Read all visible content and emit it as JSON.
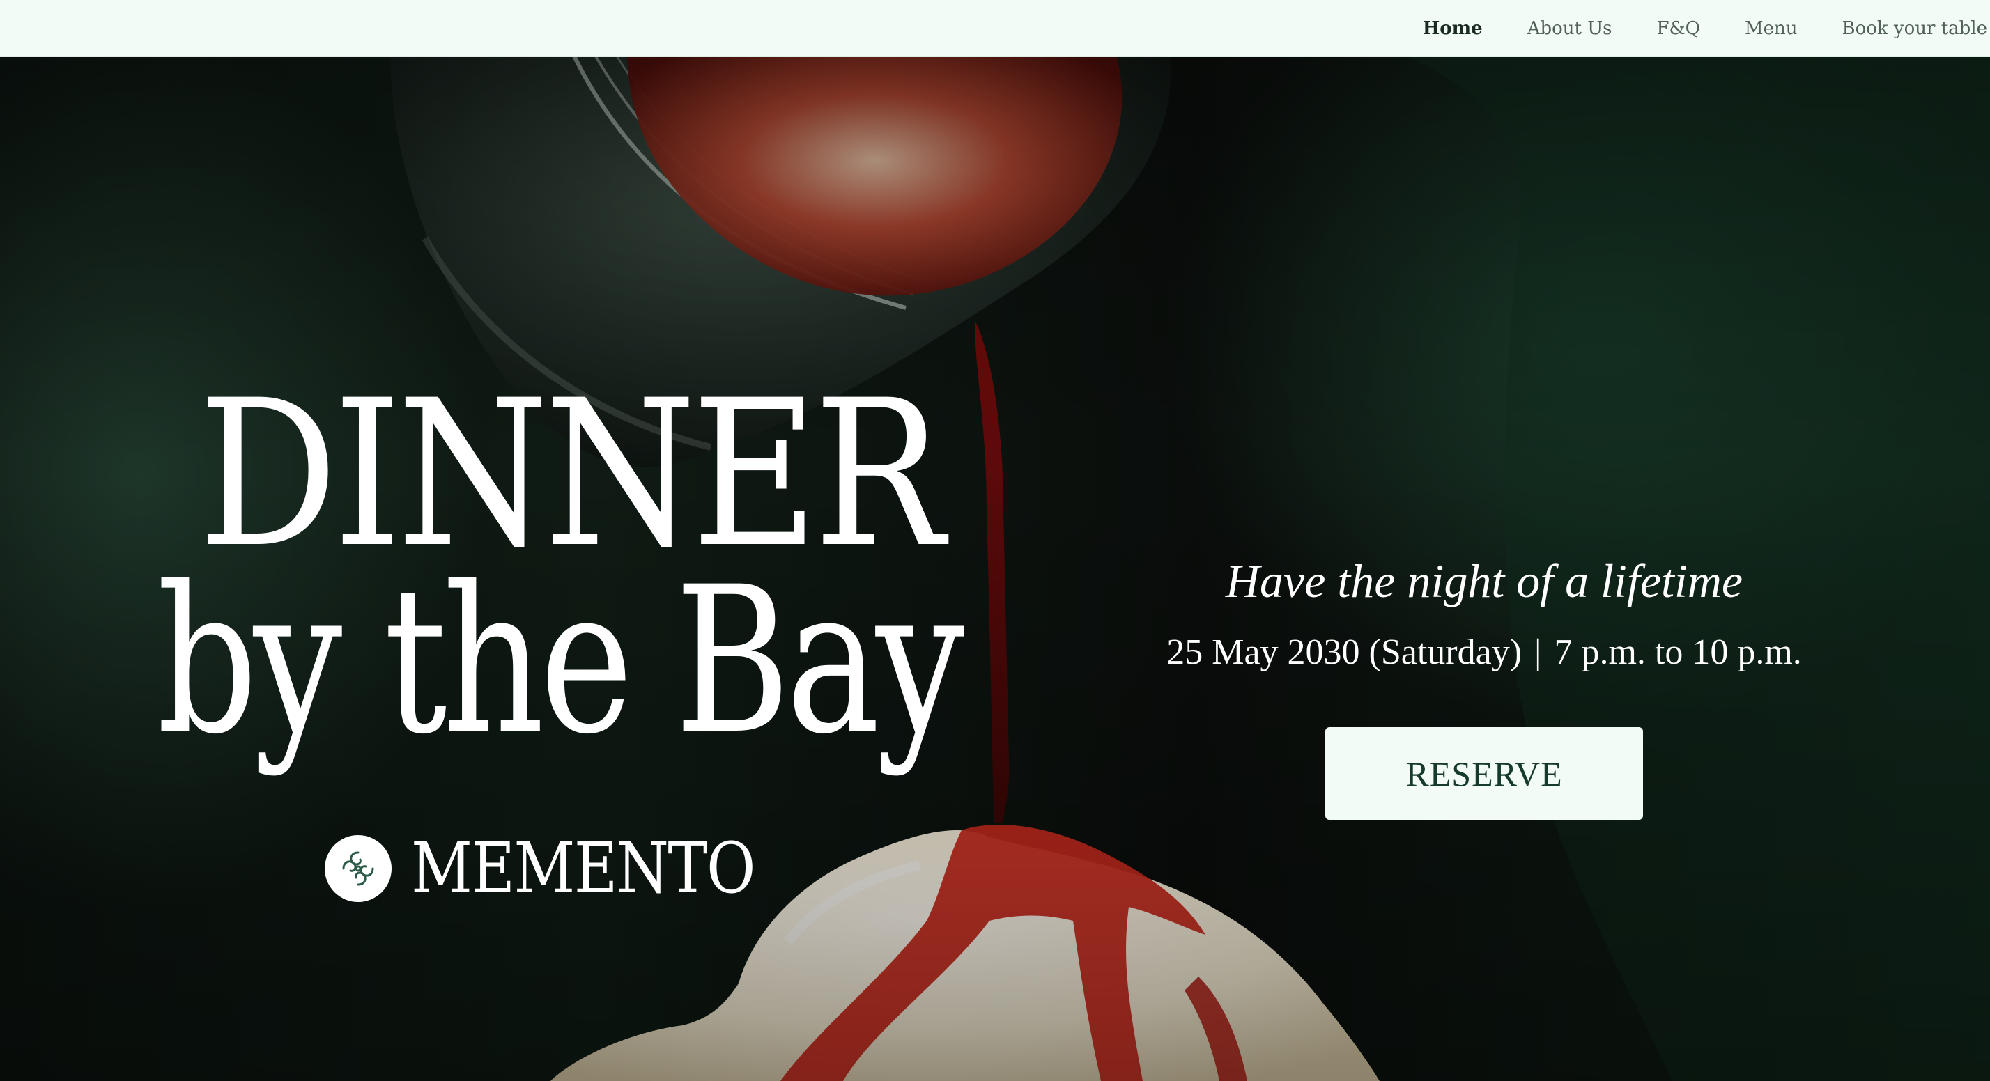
{
  "nav": {
    "items": [
      {
        "label": "Home",
        "active": true
      },
      {
        "label": "About Us",
        "active": false
      },
      {
        "label": "F&Q",
        "active": false
      },
      {
        "label": "Menu",
        "active": false
      },
      {
        "label": "Book your table",
        "active": false
      }
    ]
  },
  "hero": {
    "title_line1": "DINNER",
    "title_line2": "by the Bay",
    "brand_name": "MEMENTO",
    "tagline": "Have the night of a lifetime",
    "date": "25 May 2030 (Saturday)",
    "separator": "|",
    "time": "7 p.m. to 10 p.m.",
    "reserve_label": "RESERVE"
  },
  "colors": {
    "nav_bg": "#f3fbf6",
    "hero_bg": "#0f1b14",
    "button_bg": "#f3fbf6",
    "button_text": "#163a2c",
    "syrup": "#8c1414",
    "ice_cream": "#f3ead2"
  },
  "icons": {
    "brand_mark": "swirl-logo-icon"
  }
}
